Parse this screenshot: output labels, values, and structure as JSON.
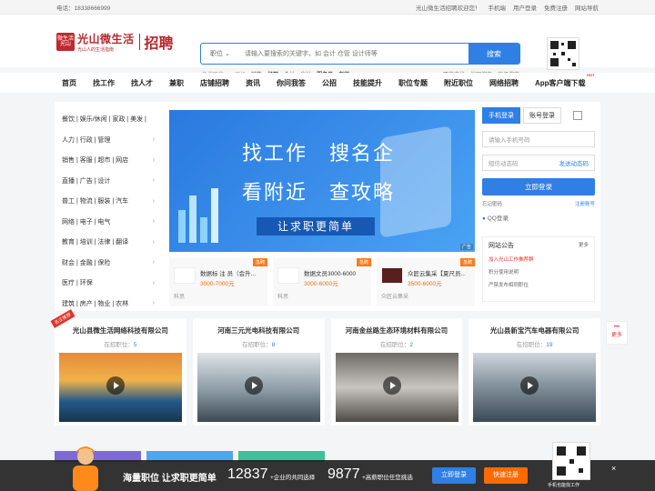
{
  "topbar": {
    "phone": "电话：18338666999",
    "welcome": "光山微生活招聘欢迎您！",
    "links": [
      "手机端",
      "用户登录",
      "免费注册",
      "网站导航"
    ]
  },
  "logo": {
    "mark": "微生活光山",
    "title": "光山微生活",
    "subtitle": "光山人的生活指南",
    "product": "招聘"
  },
  "search": {
    "category": "职位",
    "placeholder": "请输入要搜索的关键字，如 会计 仓管 设计师等",
    "button": "搜索"
  },
  "hot": {
    "label": "热搜职位：",
    "items": [
      "司机",
      "销售",
      "经理",
      "会计",
      "出纳",
      "服务员",
      "老师"
    ]
  },
  "header_links": [
    "职位速找",
    "地图搜索",
    "高级搜索"
  ],
  "nav": [
    "首页",
    "找工作",
    "找人才",
    "兼职",
    "店铺招聘",
    "资讯",
    "你问我答",
    "公招",
    "技能提升",
    "职位专题",
    "附近职位",
    "网络招聘",
    "App客户端下载"
  ],
  "nav_badge": "HOT",
  "categories": [
    "餐饮 | 娱乐/休闲 | 家政 | 美发 |",
    "人力 | 行政 | 管理",
    "销售 | 客服 | 超市 | 网店",
    "直播 | 广告 | 设计",
    "普工 | 物流 | 服装 | 汽车",
    "网络 | 电子 | 电气",
    "教育 | 培训 | 法律 | 翻译",
    "财会 | 金融 | 保险",
    "医疗 | 环保",
    "建筑 | 房产 | 物业 | 农林"
  ],
  "banner": {
    "line1": "找工作　搜名企",
    "line2": "看附近　查攻略",
    "line3": "让求职更简单",
    "ad": "广告"
  },
  "jobs": [
    {
      "tag": "急聘",
      "name": "数据标 注 员（会升...",
      "salary": "3000-7000元",
      "company": "科思"
    },
    {
      "tag": "急聘",
      "name": "数据文员3000-6000",
      "salary": "3000-6000元",
      "company": "科思"
    },
    {
      "tag": "急聘",
      "name": "众匠云集采【夏尺员...",
      "salary": "3500-6000元",
      "company": "众匠云集采"
    }
  ],
  "login": {
    "tab_phone": "手机登录",
    "tab_account": "账号登录",
    "phone_placeholder": "请输入手机号码",
    "code_placeholder": "短信动态码",
    "send_code": "发送动态码",
    "submit": "立即登录",
    "forgot": "忘记密码",
    "register": "注册账号",
    "qq": "QQ登录"
  },
  "notice": {
    "title": "网站公告",
    "more": "更多",
    "items": [
      "加入光山工作推荐群",
      "积分使用说明",
      "严禁发布相同职位"
    ]
  },
  "companies": [
    {
      "name": "光山县微生活网络科技有限公司",
      "label": "在招职位：",
      "count": "5",
      "badge": "名企推荐"
    },
    {
      "name": "河南三元光电科技有限公司",
      "label": "在招职位：",
      "count": "8"
    },
    {
      "name": "河南金丝路生态环境材料有限公司",
      "label": "在招职位：",
      "count": "2"
    },
    {
      "name": "光山县新宝汽车电器有限公司",
      "label": "在招职位：",
      "count": "19"
    }
  ],
  "side_more": "更多",
  "bottom": {
    "slogan": "海量职位 让求职更简单",
    "count1": "12837",
    "text1": "+企业的共同选择",
    "count2": "9877",
    "text2": "+高薪职位任您挑选",
    "login": "立即登录",
    "register": "快速注册",
    "qr_text": "手机也能找工作",
    "close": "×"
  },
  "colors": {
    "primary": "#2f7fe4",
    "brand": "#b8262b",
    "accent": "#ff6a00"
  }
}
